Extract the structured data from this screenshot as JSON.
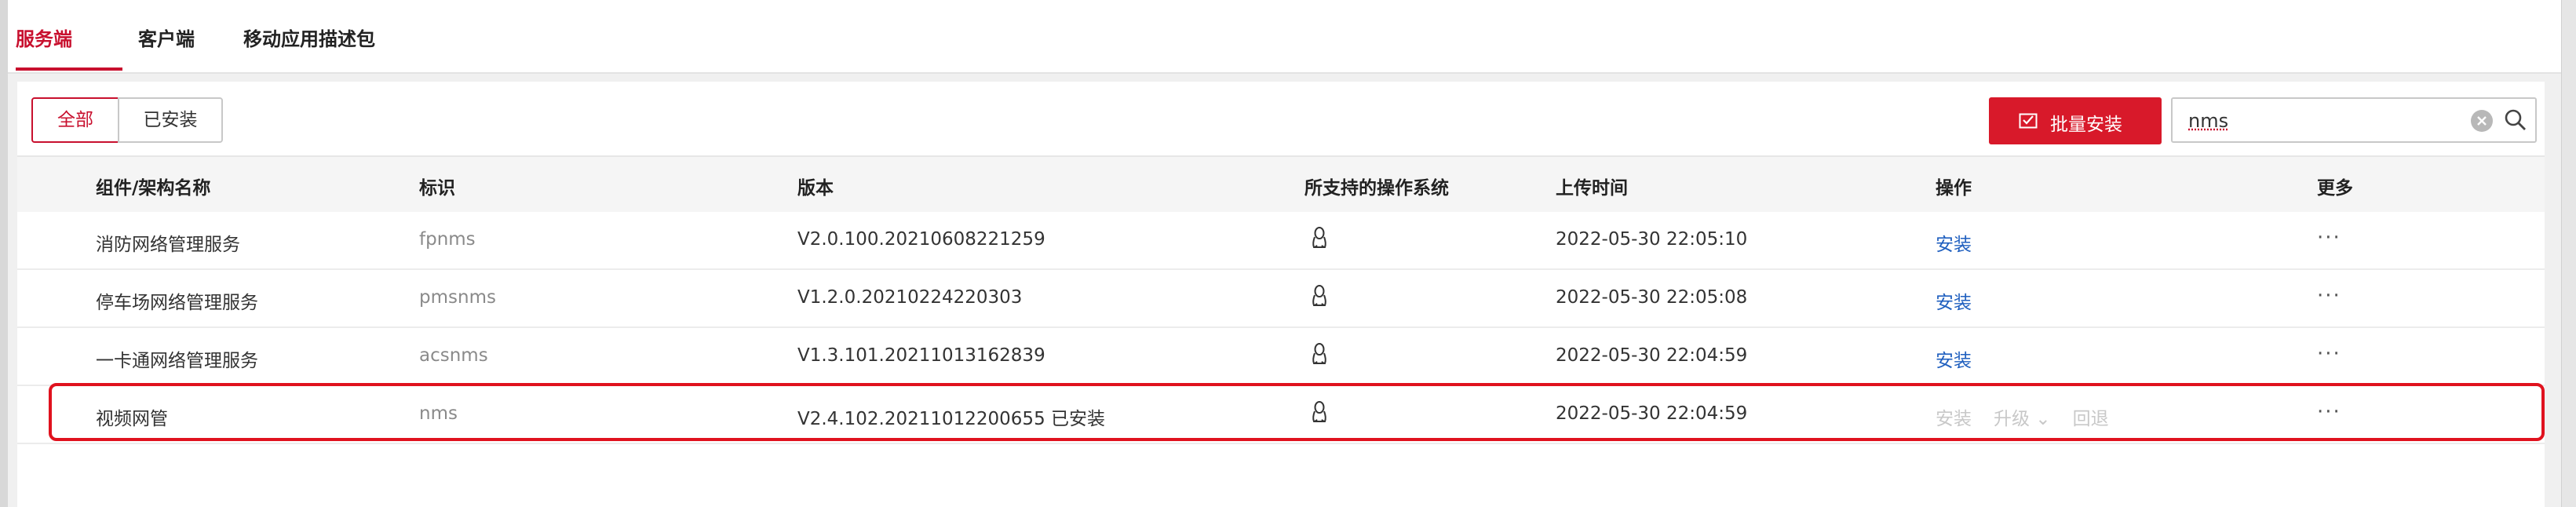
{
  "tabs": [
    {
      "label": "服务端",
      "active": true
    },
    {
      "label": "客户端",
      "active": false
    },
    {
      "label": "移动应用描述包",
      "active": false
    }
  ],
  "filter": {
    "all": "全部",
    "installed": "已安装"
  },
  "toolbar": {
    "batch_install": "批量安装"
  },
  "search": {
    "value": "nms"
  },
  "colors": {
    "accent": "#d8192a",
    "link": "#1f5fbf",
    "highlight": "#e0121e"
  },
  "table": {
    "columns": [
      "组件/架构名称",
      "标识",
      "版本",
      "所支持的操作系统",
      "上传时间",
      "操作",
      "更多"
    ],
    "rows": [
      {
        "name": "消防网络管理服务",
        "id": "fpnms",
        "version": "V2.0.100.20210608221259",
        "os": "linux-icon",
        "time": "2022-05-30 22:05:10",
        "action": "安装",
        "more": "···"
      },
      {
        "name": "停车场网络管理服务",
        "id": "pmsnms",
        "version": "V1.2.0.20210224220303",
        "os": "linux-icon",
        "time": "2022-05-30 22:05:08",
        "action": "安装",
        "more": "···"
      },
      {
        "name": "一卡通网络管理服务",
        "id": "acsnms",
        "version": "V1.3.101.20211013162839",
        "os": "linux-icon",
        "time": "2022-05-30 22:04:59",
        "action": "安装",
        "more": "···"
      },
      {
        "name": "视频网管",
        "id": "nms",
        "version": "V2.4.102.20211012200655 已安装",
        "os": "linux-icon",
        "time": "2022-05-30 22:04:59",
        "action": "安装",
        "action2": "升级 ⌄",
        "action3": "回退",
        "more": "···"
      }
    ]
  }
}
